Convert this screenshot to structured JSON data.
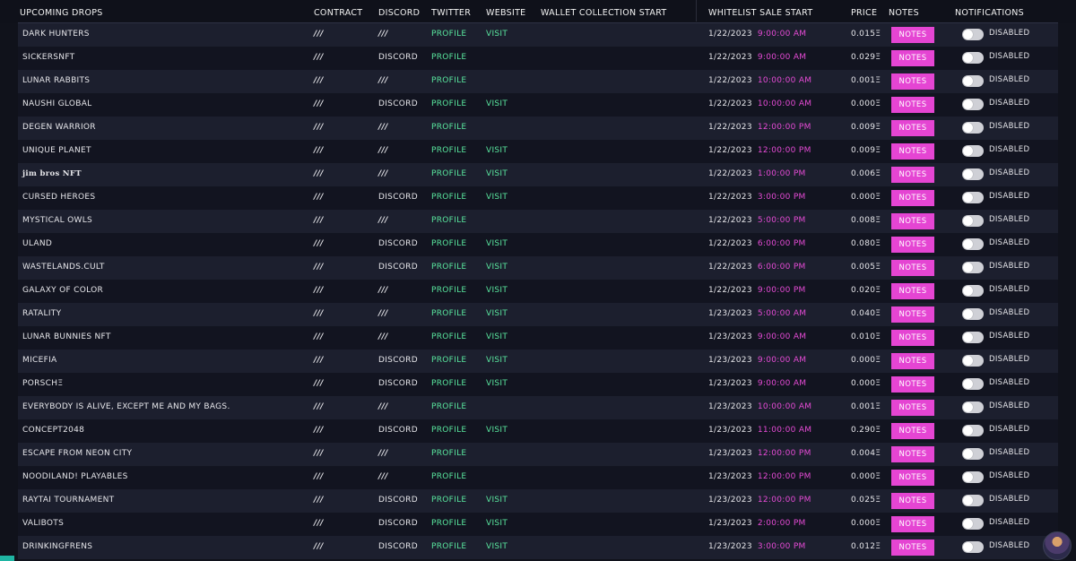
{
  "header": {
    "upcoming_drops": "UPCOMING DROPS",
    "contract": "CONTRACT",
    "discord": "DISCORD",
    "twitter": "TWITTER",
    "website": "WEBSITE",
    "wallet_collection_start": "WALLET COLLECTION START",
    "whitelist_sale_start": "WHITELIST SALE START",
    "price": "PRICE",
    "notes": "NOTES",
    "notifications": "NOTIFICATIONS"
  },
  "labels": {
    "notes_button": "NOTES",
    "toggle_state": "DISABLED",
    "profile": "PROFILE",
    "visit": "VISIT",
    "discord": "DISCORD",
    "na": "///"
  },
  "colors": {
    "accent_pink": "#e545d3",
    "link_green": "#59e69e",
    "time_pink": "#e64bd6"
  },
  "rows": [
    {
      "name": "DARK HUNTERS",
      "contract": "///",
      "discord": "///",
      "twitter": "PROFILE",
      "website": "VISIT",
      "date": "1/22/2023",
      "time": "9:00:00 AM",
      "price": "0.015Ξ"
    },
    {
      "name": "SICKERSNFT",
      "contract": "///",
      "discord": "DISCORD",
      "twitter": "PROFILE",
      "website": "",
      "date": "1/22/2023",
      "time": "9:00:00 AM",
      "price": "0.029Ξ"
    },
    {
      "name": "LUNAR RABBITS",
      "contract": "///",
      "discord": "///",
      "twitter": "PROFILE",
      "website": "",
      "date": "1/22/2023",
      "time": "10:00:00 AM",
      "price": "0.001Ξ"
    },
    {
      "name": "NAUSHI GLOBAL",
      "contract": "///",
      "discord": "DISCORD",
      "twitter": "PROFILE",
      "website": "VISIT",
      "date": "1/22/2023",
      "time": "10:00:00 AM",
      "price": "0.000Ξ"
    },
    {
      "name": "DEGEN WARRIOR",
      "contract": "///",
      "discord": "///",
      "twitter": "PROFILE",
      "website": "",
      "date": "1/22/2023",
      "time": "12:00:00 PM",
      "price": "0.009Ξ"
    },
    {
      "name": "UNIQUE PLANET",
      "contract": "///",
      "discord": "///",
      "twitter": "PROFILE",
      "website": "VISIT",
      "date": "1/22/2023",
      "time": "12:00:00 PM",
      "price": "0.009Ξ"
    },
    {
      "name": "jim bros NFT",
      "contract": "///",
      "discord": "///",
      "twitter": "PROFILE",
      "website": "VISIT",
      "date": "1/22/2023",
      "time": "1:00:00 PM",
      "price": "0.006Ξ",
      "serif": true
    },
    {
      "name": "CURSED HEROES",
      "contract": "///",
      "discord": "DISCORD",
      "twitter": "PROFILE",
      "website": "VISIT",
      "date": "1/22/2023",
      "time": "3:00:00 PM",
      "price": "0.000Ξ"
    },
    {
      "name": "MYSTICAL OWLS",
      "contract": "///",
      "discord": "///",
      "twitter": "PROFILE",
      "website": "",
      "date": "1/22/2023",
      "time": "5:00:00 PM",
      "price": "0.008Ξ"
    },
    {
      "name": "ULAND",
      "contract": "///",
      "discord": "DISCORD",
      "twitter": "PROFILE",
      "website": "VISIT",
      "date": "1/22/2023",
      "time": "6:00:00 PM",
      "price": "0.080Ξ"
    },
    {
      "name": "WASTELANDS.CULT",
      "contract": "///",
      "discord": "DISCORD",
      "twitter": "PROFILE",
      "website": "VISIT",
      "date": "1/22/2023",
      "time": "6:00:00 PM",
      "price": "0.005Ξ"
    },
    {
      "name": "GALAXY OF COLOR",
      "contract": "///",
      "discord": "///",
      "twitter": "PROFILE",
      "website": "VISIT",
      "date": "1/22/2023",
      "time": "9:00:00 PM",
      "price": "0.020Ξ"
    },
    {
      "name": "RATALITY",
      "contract": "///",
      "discord": "///",
      "twitter": "PROFILE",
      "website": "VISIT",
      "date": "1/23/2023",
      "time": "5:00:00 AM",
      "price": "0.040Ξ"
    },
    {
      "name": "LUNAR BUNNIES NFT",
      "contract": "///",
      "discord": "///",
      "twitter": "PROFILE",
      "website": "VISIT",
      "date": "1/23/2023",
      "time": "9:00:00 AM",
      "price": "0.010Ξ"
    },
    {
      "name": "MICEFIA",
      "contract": "///",
      "discord": "DISCORD",
      "twitter": "PROFILE",
      "website": "VISIT",
      "date": "1/23/2023",
      "time": "9:00:00 AM",
      "price": "0.000Ξ"
    },
    {
      "name": "PORSCHΞ",
      "contract": "///",
      "discord": "DISCORD",
      "twitter": "PROFILE",
      "website": "VISIT",
      "date": "1/23/2023",
      "time": "9:00:00 AM",
      "price": "0.000Ξ"
    },
    {
      "name": "EVERYBODY IS ALIVE, EXCEPT ME AND MY BAGS.",
      "contract": "///",
      "discord": "///",
      "twitter": "PROFILE",
      "website": "",
      "date": "1/23/2023",
      "time": "10:00:00 AM",
      "price": "0.001Ξ"
    },
    {
      "name": "CONCEPT2048",
      "contract": "///",
      "discord": "DISCORD",
      "twitter": "PROFILE",
      "website": "VISIT",
      "date": "1/23/2023",
      "time": "11:00:00 AM",
      "price": "0.290Ξ"
    },
    {
      "name": "ESCAPE FROM NEON CITY",
      "contract": "///",
      "discord": "///",
      "twitter": "PROFILE",
      "website": "",
      "date": "1/23/2023",
      "time": "12:00:00 PM",
      "price": "0.004Ξ"
    },
    {
      "name": "NOODILAND! PLAYABLES",
      "contract": "///",
      "discord": "///",
      "twitter": "PROFILE",
      "website": "",
      "date": "1/23/2023",
      "time": "12:00:00 PM",
      "price": "0.000Ξ"
    },
    {
      "name": "RAYTAI TOURNAMENT",
      "contract": "///",
      "discord": "DISCORD",
      "twitter": "PROFILE",
      "website": "VISIT",
      "date": "1/23/2023",
      "time": "12:00:00 PM",
      "price": "0.025Ξ"
    },
    {
      "name": "VALIBOTS",
      "contract": "///",
      "discord": "DISCORD",
      "twitter": "PROFILE",
      "website": "VISIT",
      "date": "1/23/2023",
      "time": "2:00:00 PM",
      "price": "0.000Ξ"
    },
    {
      "name": "DRINKINGFRENS",
      "contract": "///",
      "discord": "DISCORD",
      "twitter": "PROFILE",
      "website": "VISIT",
      "date": "1/23/2023",
      "time": "3:00:00 PM",
      "price": "0.012Ξ"
    }
  ]
}
